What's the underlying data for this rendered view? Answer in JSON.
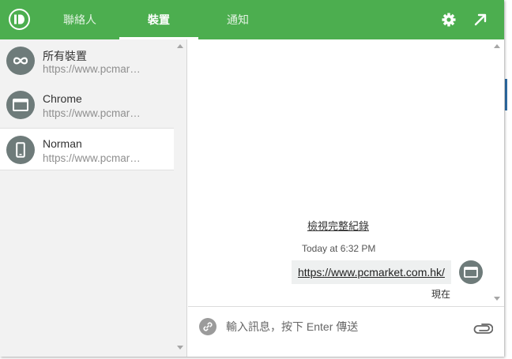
{
  "header": {
    "tabs": [
      {
        "label": "聯絡人",
        "active": false
      },
      {
        "label": "裝置",
        "active": true
      },
      {
        "label": "通知",
        "active": false
      }
    ],
    "icons": [
      "gear-icon",
      "popout-arrow-icon"
    ]
  },
  "devices": [
    {
      "name": "所有裝置",
      "url": "https://www.pcmar…",
      "icon": "infinity-icon",
      "selected": false
    },
    {
      "name": "Chrome",
      "url": "https://www.pcmar…",
      "icon": "browser-window-icon",
      "selected": false
    },
    {
      "name": "Norman",
      "url": "https://www.pcmar…",
      "icon": "phone-icon",
      "selected": true
    }
  ],
  "chat": {
    "history_link": "檢視完整紀錄",
    "message": {
      "time": "Today at 6:32 PM",
      "text": "https://www.pcmarket.com.hk/",
      "status": "現在"
    }
  },
  "composer": {
    "placeholder": "輸入訊息，按下 Enter 傳送"
  },
  "colors": {
    "brand": "#4cae4f",
    "avatar": "#6e7b7a",
    "sidebar_bg": "#f2f2f2"
  }
}
